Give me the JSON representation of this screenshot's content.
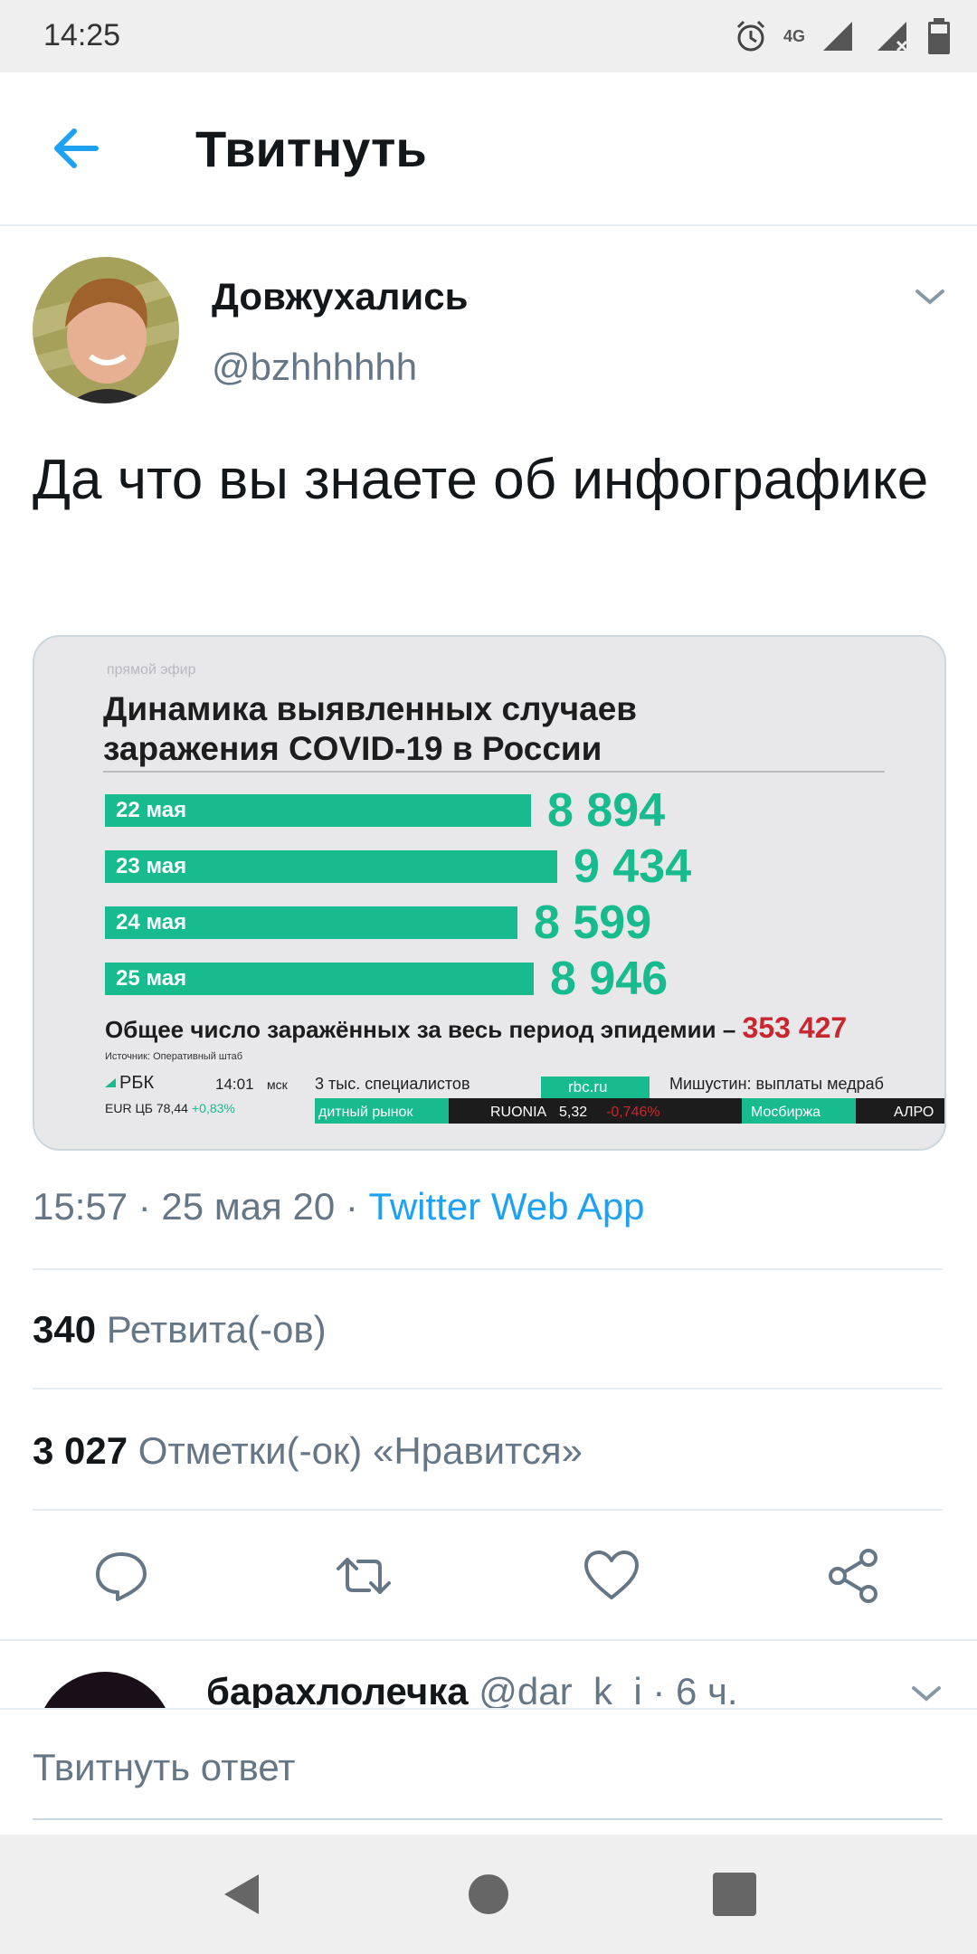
{
  "status_bar": {
    "time": "14:25",
    "network": "4G"
  },
  "header": {
    "title": "Твитнуть"
  },
  "tweet": {
    "author_name": "Довжухались",
    "author_handle": "@bzhhhhhh",
    "text": "Да что вы знаете об инфографике",
    "timestamp": "15:57 · 25 мая 20 · ",
    "source_app": "Twitter Web App",
    "retweets_count": "340",
    "retweets_label": "Ретвита(-ов)",
    "likes_count": "3 027",
    "likes_label": "Отметки(-ок) «Нравится»"
  },
  "media": {
    "live_label": "прямой эфир",
    "title_line1": "Динамика выявленных случаев",
    "title_line2": "заражения COVID-19 в России",
    "total_label": "Общее число заражённых за весь период эпидемии –",
    "total_value": "353 427",
    "source_label": "Источник: Оперативный штаб",
    "ticker": {
      "brand": "РБК",
      "time": "14:01",
      "tz": "мск",
      "headline": "3 тыс. специалистов",
      "site": "rbc.ru",
      "news": "Мишустин: выплаты медраб",
      "eur": "EUR ЦБ 78,44",
      "eur_change": "+0,83%",
      "market": "дитный рынок",
      "ruonia": "RUONIA",
      "ruonia_value": "5,32",
      "ruonia_change": "-0,746%",
      "exchange": "Мосбиржа",
      "alrosa": "АЛРО"
    },
    "chart_data": {
      "type": "bar",
      "categories": [
        "22 мая",
        "23 мая",
        "24 мая",
        "25 мая"
      ],
      "values": [
        8894,
        9434,
        8599,
        8946
      ],
      "value_labels": [
        "8 894",
        "9 434",
        "8 599",
        "8 946"
      ],
      "title": "Динамика выявленных случаев заражения COVID-19 в России",
      "orientation": "horizontal",
      "colors": {
        "bar": "#17bb8d",
        "total": "#c8272e"
      }
    }
  },
  "reply": {
    "author_name": "барахлолечка",
    "author_handle": "@dar_k_i",
    "time": " · 6 ч."
  },
  "compose": {
    "placeholder": "Твитнуть ответ"
  },
  "colors": {
    "accent": "#1da1f2",
    "muted": "#657786",
    "text": "#14171a"
  }
}
